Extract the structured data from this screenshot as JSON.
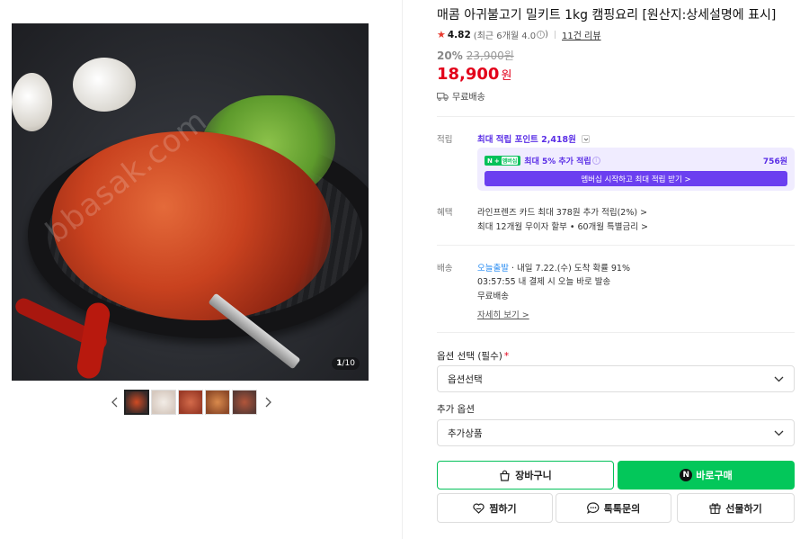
{
  "product": {
    "title": "매콤 아귀불고기 밀키트 1kg 캠핑요리 [원산지:상세설명에 표시]",
    "image_counter_current": "1",
    "image_counter_total": "/10",
    "watermark": "bbasak.com"
  },
  "rating": {
    "score": "4.82",
    "recent_label": "(최근 6개월 4.0",
    "recent_close": ")",
    "info_glyph": "i",
    "reviews": "11건 리뷰"
  },
  "pricing": {
    "discount": "20%",
    "original_price": "23,900원",
    "price": "18,900",
    "currency": "원",
    "shipping": "무료배송"
  },
  "points": {
    "label": "적립",
    "max_points": "최대 적립 포인트 2,418원",
    "member_badge": "N",
    "member_badge_plus": "+",
    "member_badge_sub": "멤버십",
    "member_text": "최대 5% 추가 적립",
    "member_amount": "756원",
    "member_button": "멤버십 시작하고 최대 적립 받기 >"
  },
  "benefits": {
    "label": "혜택",
    "line1": "라인프렌즈 카드 최대 378원 추가 적립(2%) >",
    "line2": "최대 12개월 무이자 할부 • 60개월 특별금리 >"
  },
  "delivery": {
    "label": "배송",
    "today": "오늘출발",
    "line1_rest": "· 내일 7.22.(수) 도착 확률 91%",
    "line2": "03:57:55  내 결제 시 오늘 바로 발송",
    "line3": "무료배송",
    "details_link": "자세히 보기 >"
  },
  "options": {
    "required_label": "옵션 선택 (필수)",
    "required_mark": "*",
    "required_value": "옵션선택",
    "additional_label": "추가 옵션",
    "additional_value": "추가상품"
  },
  "actions": {
    "cart": "장바구니",
    "buy_now": "바로구매",
    "buy_icon_letter": "N",
    "wishlist": "찜하기",
    "talk": "톡톡문의",
    "gift": "선물하기"
  },
  "colors": {
    "price_red": "#e2001a",
    "naver_green": "#03c75a",
    "membership_purple": "#6b3ff0",
    "star": "#e8382d"
  },
  "icons": [
    "star-icon",
    "truck-icon",
    "chevron-left-icon",
    "chevron-right-icon",
    "chevron-down-icon",
    "bag-icon",
    "heart-icon",
    "chat-icon",
    "gift-icon"
  ]
}
